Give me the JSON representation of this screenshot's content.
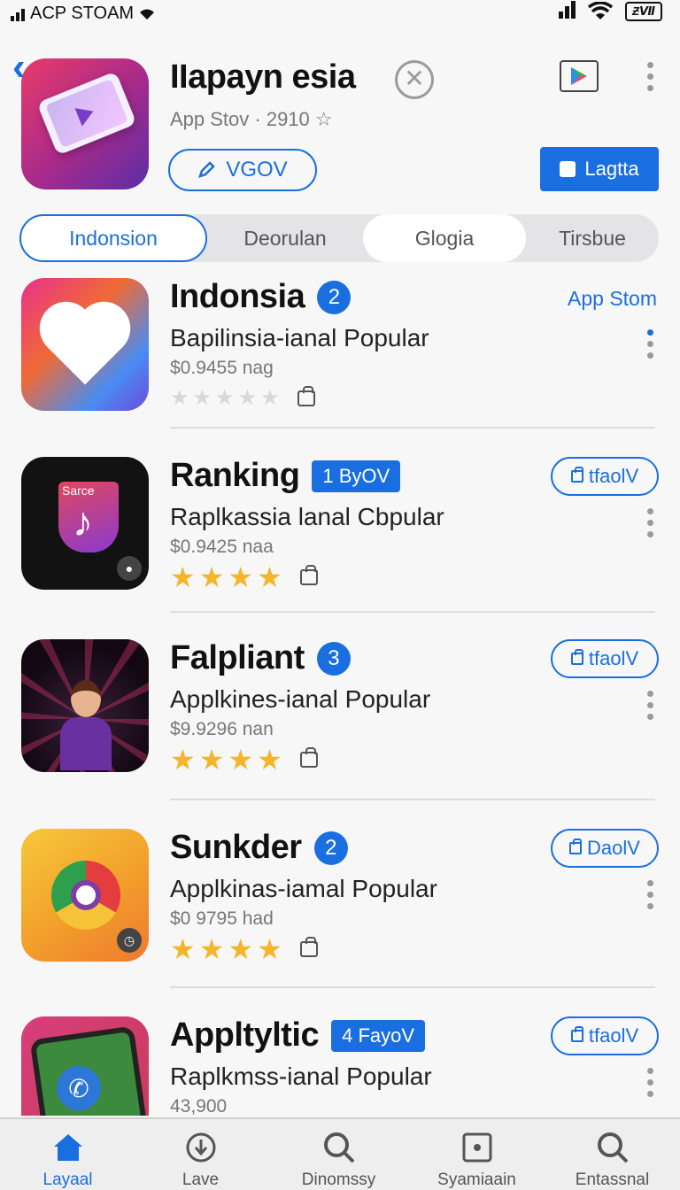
{
  "status_bar": {
    "carrier": "ACP STOAM",
    "battery": "ƵⅦ"
  },
  "header": {
    "title": "IIapayn esia",
    "subtitle": "App Stov  ·  2910 ☆",
    "outline_button": "VGOV",
    "primary_button": "Lagtta"
  },
  "segments": [
    "Indonsion",
    "Deorulan",
    "Glogia",
    "Tirsbue"
  ],
  "apps": [
    {
      "title": "Indonsia",
      "badge": "2",
      "badge_style": "circle",
      "subtitle": "Bapilinsia-ianal Popular",
      "price": "$0.9455 nag",
      "rating": 0,
      "action": "App Stom",
      "action_style": "link",
      "icon": "heart-icon"
    },
    {
      "title": "Ranking",
      "badge": "1 ByOV",
      "badge_style": "pill",
      "subtitle": "Raplkassia lanal Cbpular",
      "price": "$0.9425 naa",
      "rating": 4,
      "action": "tfaolV",
      "action_style": "button",
      "icon": "music-note-icon",
      "icon_label": "Sarce"
    },
    {
      "title": "Falpliant",
      "badge": "3",
      "badge_style": "circle",
      "subtitle": "Applkines-ianal Popular",
      "price": "$9.9296 nan",
      "rating": 4,
      "action": "tfaolV",
      "action_style": "button",
      "icon": "game-character-icon"
    },
    {
      "title": "Sunkder",
      "badge": "2",
      "badge_style": "circle",
      "subtitle": "Applkinas-iamal Popular",
      "price": "$0 9795 had",
      "rating": 4,
      "action": "DaolV",
      "action_style": "button",
      "icon": "chrome-icon"
    },
    {
      "title": "Appltyltic",
      "badge": "4 FayoV",
      "badge_style": "pill",
      "subtitle": "Raplkmss-ianal Popular",
      "price": "43,900",
      "rating": 0,
      "action": "tfaolV",
      "action_style": "button",
      "icon": "phone-call-icon"
    }
  ],
  "tab_bar": [
    {
      "label": "Layaal",
      "icon": "home-icon",
      "active": true
    },
    {
      "label": "Lave",
      "icon": "download-icon",
      "active": false
    },
    {
      "label": "Dinomssy",
      "icon": "search-icon",
      "active": false
    },
    {
      "label": "Syamiaain",
      "icon": "screen-icon",
      "active": false
    },
    {
      "label": "Entassnal",
      "icon": "search-icon",
      "active": false
    }
  ],
  "colors": {
    "accent": "#1a6fe0",
    "star": "#f5b52a",
    "background": "#f7f7f8"
  }
}
